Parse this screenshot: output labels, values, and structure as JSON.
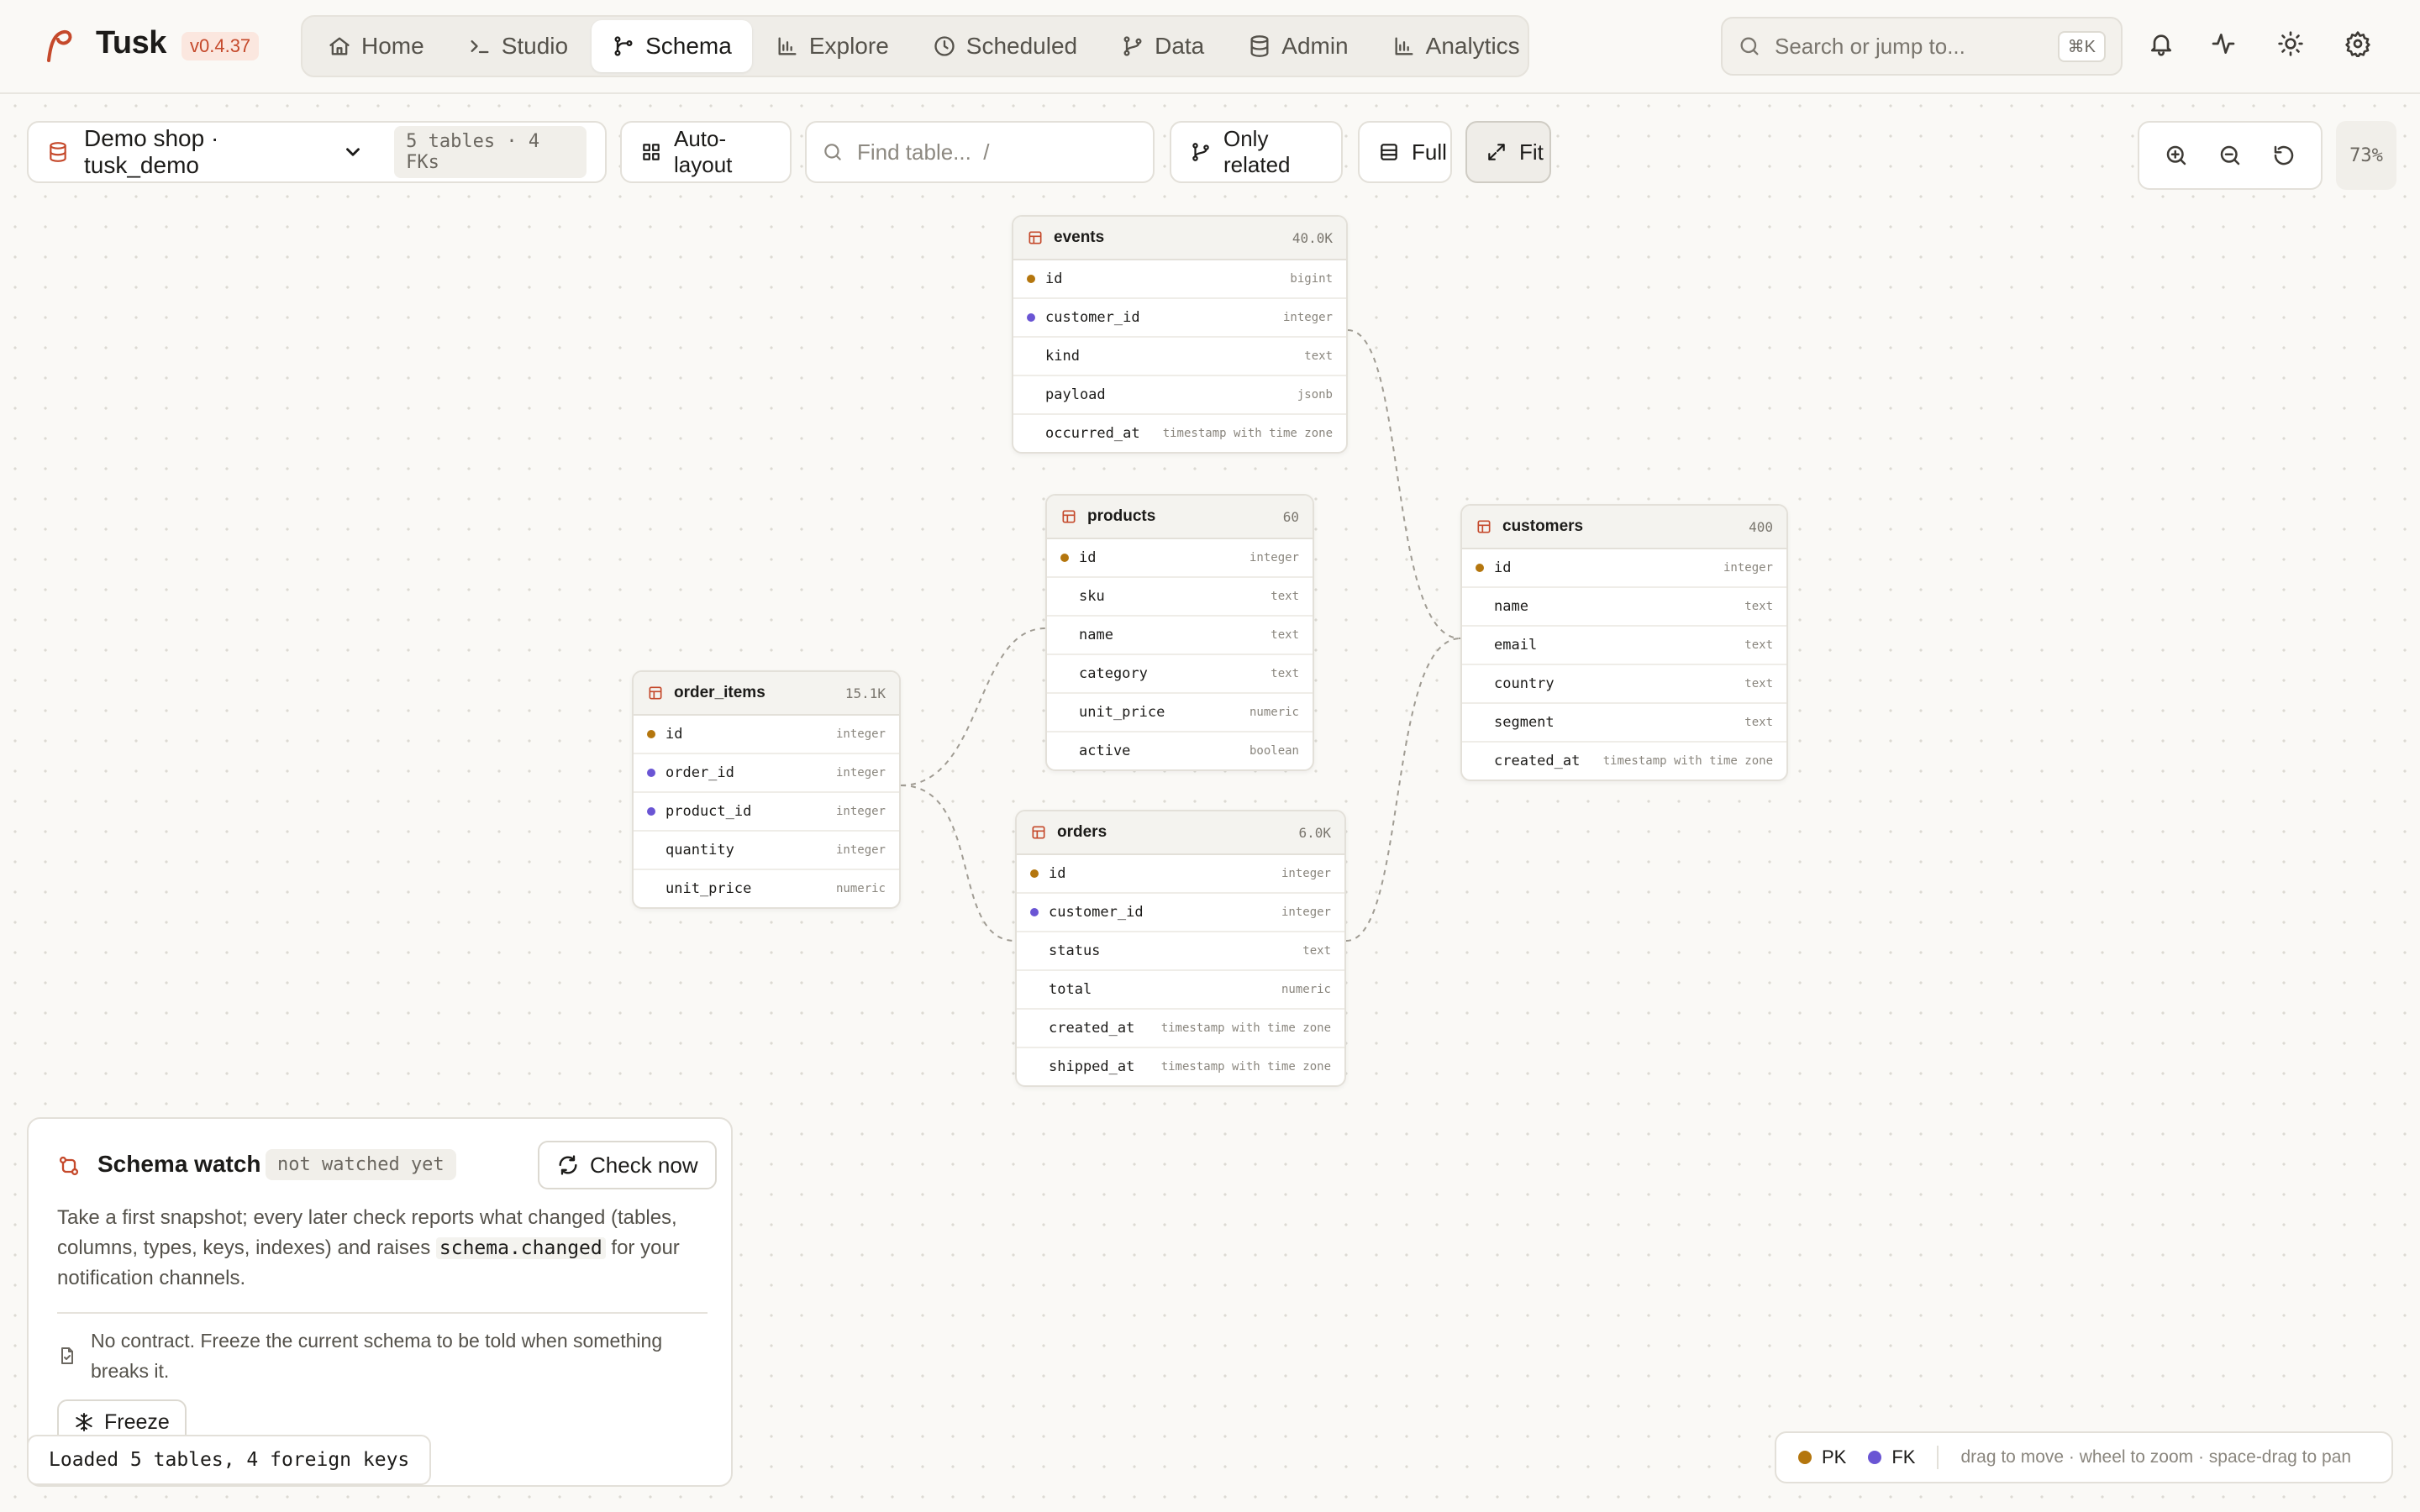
{
  "app": {
    "name": "Tusk",
    "version": "v0.4.37"
  },
  "nav": [
    {
      "label": "Home",
      "icon": "home-icon",
      "active": false
    },
    {
      "label": "Studio",
      "icon": "terminal-icon",
      "active": false
    },
    {
      "label": "Schema",
      "icon": "schema-icon",
      "active": true
    },
    {
      "label": "Explore",
      "icon": "bar-chart-icon",
      "active": false
    },
    {
      "label": "Scheduled",
      "icon": "clock-icon",
      "active": false
    },
    {
      "label": "Data",
      "icon": "branch-icon",
      "active": false
    },
    {
      "label": "Admin",
      "icon": "database-icon",
      "active": false
    },
    {
      "label": "Analytics",
      "icon": "bar-chart-icon",
      "active": false
    }
  ],
  "search": {
    "placeholder": "Search or jump to...",
    "shortcut": "⌘K"
  },
  "toolbar": {
    "database": "Demo shop · tusk_demo",
    "summary": "5 tables · 4 FKs",
    "auto_layout": "Auto-layout",
    "find_placeholder": "Find table...  /",
    "only_related": "Only related",
    "full": "Full",
    "fit": "Fit",
    "zoom": "73%"
  },
  "tables": {
    "events": {
      "name": "events",
      "count": "40.0K",
      "columns": [
        {
          "name": "id",
          "type": "bigint",
          "key": "pk"
        },
        {
          "name": "customer_id",
          "type": "integer",
          "key": "fk"
        },
        {
          "name": "kind",
          "type": "text",
          "key": ""
        },
        {
          "name": "payload",
          "type": "jsonb",
          "key": ""
        },
        {
          "name": "occurred_at",
          "type": "timestamp with time zone",
          "key": ""
        }
      ]
    },
    "products": {
      "name": "products",
      "count": "60",
      "columns": [
        {
          "name": "id",
          "type": "integer",
          "key": "pk"
        },
        {
          "name": "sku",
          "type": "text",
          "key": ""
        },
        {
          "name": "name",
          "type": "text",
          "key": ""
        },
        {
          "name": "category",
          "type": "text",
          "key": ""
        },
        {
          "name": "unit_price",
          "type": "numeric",
          "key": ""
        },
        {
          "name": "active",
          "type": "boolean",
          "key": ""
        }
      ]
    },
    "customers": {
      "name": "customers",
      "count": "400",
      "columns": [
        {
          "name": "id",
          "type": "integer",
          "key": "pk"
        },
        {
          "name": "name",
          "type": "text",
          "key": ""
        },
        {
          "name": "email",
          "type": "text",
          "key": ""
        },
        {
          "name": "country",
          "type": "text",
          "key": ""
        },
        {
          "name": "segment",
          "type": "text",
          "key": ""
        },
        {
          "name": "created_at",
          "type": "timestamp with time zone",
          "key": ""
        }
      ]
    },
    "order_items": {
      "name": "order_items",
      "count": "15.1K",
      "columns": [
        {
          "name": "id",
          "type": "integer",
          "key": "pk"
        },
        {
          "name": "order_id",
          "type": "integer",
          "key": "fk"
        },
        {
          "name": "product_id",
          "type": "integer",
          "key": "fk"
        },
        {
          "name": "quantity",
          "type": "integer",
          "key": ""
        },
        {
          "name": "unit_price",
          "type": "numeric",
          "key": ""
        }
      ]
    },
    "orders": {
      "name": "orders",
      "count": "6.0K",
      "columns": [
        {
          "name": "id",
          "type": "integer",
          "key": "pk"
        },
        {
          "name": "customer_id",
          "type": "integer",
          "key": "fk"
        },
        {
          "name": "status",
          "type": "text",
          "key": ""
        },
        {
          "name": "total",
          "type": "numeric",
          "key": ""
        },
        {
          "name": "created_at",
          "type": "timestamp with time zone",
          "key": ""
        },
        {
          "name": "shipped_at",
          "type": "timestamp with time zone",
          "key": ""
        }
      ]
    }
  },
  "watch": {
    "title": "Schema watch",
    "badge": "not watched yet",
    "check_label": "Check now",
    "desc_before": "Take a first snapshot; every later check reports what changed (tables, columns, types, keys, indexes) and raises ",
    "desc_code": "schema.changed",
    "desc_after": " for your notification channels.",
    "no_contract": "No contract. Freeze the current schema to be told when something breaks it.",
    "freeze_label": "Freeze"
  },
  "status": "Loaded 5 tables, 4 foreign keys",
  "legend": {
    "pk": "PK",
    "fk": "FK",
    "hint": "drag to move · wheel to zoom · space-drag to pan"
  },
  "colors": {
    "accent": "#c5492b",
    "pk": "#b4760e",
    "fk": "#6a55d4"
  }
}
